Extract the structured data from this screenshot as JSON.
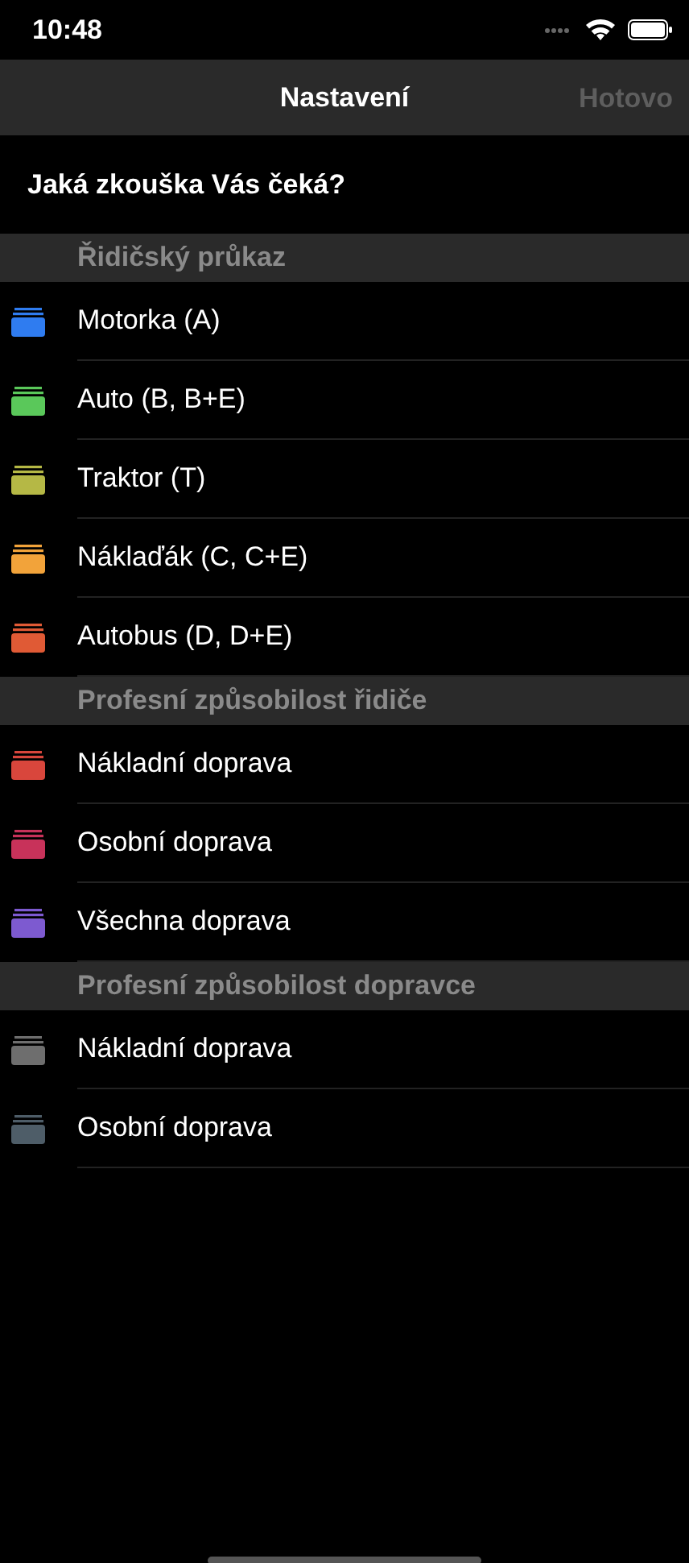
{
  "status_bar": {
    "time": "10:48"
  },
  "nav": {
    "title": "Nastavení",
    "done_button": {
      "label": "Hotovo",
      "disabled": true
    }
  },
  "question": "Jaká zkouška Vás čeká?",
  "sections": [
    {
      "title": "Řidičský průkaz",
      "items": [
        {
          "label": "Motorka (A)",
          "color": "#2f7cf0"
        },
        {
          "label": "Auto (B, B+E)",
          "color": "#5ac85a"
        },
        {
          "label": "Traktor (T)",
          "color": "#b5b845"
        },
        {
          "label": "Náklaďák (C, C+E)",
          "color": "#f2a33a"
        },
        {
          "label": "Autobus (D, D+E)",
          "color": "#e05a35"
        }
      ]
    },
    {
      "title": "Profesní způsobilost řidiče",
      "items": [
        {
          "label": "Nákladní doprava",
          "color": "#d9463c"
        },
        {
          "label": "Osobní doprava",
          "color": "#c8325a"
        },
        {
          "label": "Všechna doprava",
          "color": "#7d5ad0"
        }
      ]
    },
    {
      "title": "Profesní způsobilost dopravce",
      "items": [
        {
          "label": "Nákladní doprava",
          "color": "#6e6e6e"
        },
        {
          "label": "Osobní doprava",
          "color": "#4e5d68"
        }
      ]
    }
  ]
}
